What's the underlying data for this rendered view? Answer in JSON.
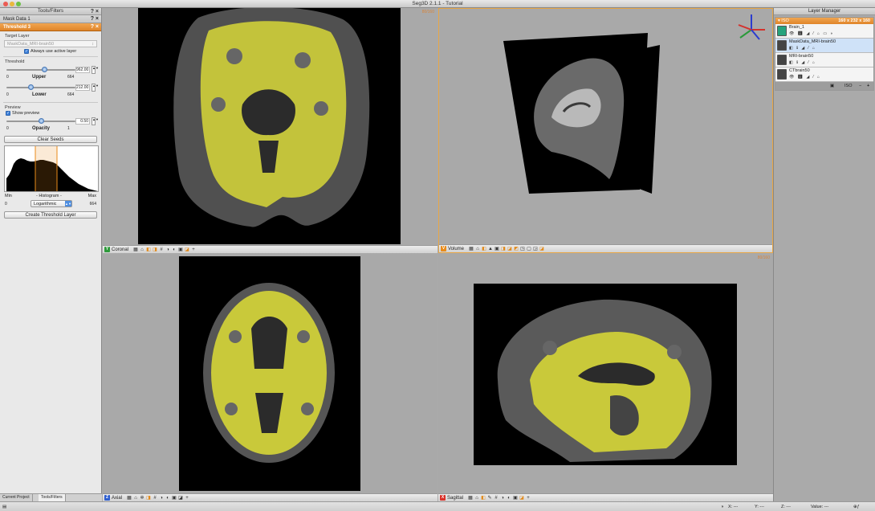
{
  "window": {
    "title": "Seg3D 2.1.1 - Tutorial"
  },
  "tools": {
    "panel_title": "Tools/Filters",
    "buttons": "? ×",
    "mask_tool": "Mask Data 1",
    "threshold_tool": "Threshold 3",
    "target_layer_label": "Target Layer",
    "target_layer_value": "MaskData_MRI-brain50",
    "always_use_active": "Always use active layer",
    "threshold_label": "Threshold",
    "upper": {
      "label": "Upper",
      "value": "962.00",
      "min": "0",
      "max": "664",
      "fraction": 0.55
    },
    "lower": {
      "label": "Lower",
      "value": "212.00",
      "min": "0",
      "max": "664",
      "fraction": 0.35
    },
    "preview_label": "Preview",
    "show_preview": "Show preview",
    "opacity": {
      "label": "Opacity",
      "value": "0.50",
      "min": "0",
      "max": "1",
      "fraction": 0.5
    },
    "clear_seeds": "Clear Seeds",
    "histogram_min": "Min",
    "histogram_title": "- Histogram -",
    "histogram_max": "Max",
    "histogram_scale_min": "0",
    "histogram_scale_max": "664",
    "histogram_mode": "Logarithmic",
    "create_layer": "Create Threshold Layer",
    "tabs": [
      "Current Project",
      "Tools/Filters"
    ]
  },
  "viewers": {
    "coronal": {
      "label": "Coronal",
      "slice": "80/160"
    },
    "volume": {
      "label": "Volume"
    },
    "axial": {
      "label": "Axial"
    },
    "sagittal": {
      "label": "Sagittal",
      "slice": "80/160"
    }
  },
  "layers": {
    "title": "Layer Manager",
    "group_label": "ISO",
    "group_dims": "160 x 232 x 160",
    "items": [
      {
        "name": "Brain_1",
        "type": "mask",
        "selected": false
      },
      {
        "name": "MaskData_MRI-brain50",
        "type": "mask",
        "selected": true
      },
      {
        "name": "MRI-brain50",
        "type": "data",
        "selected": false
      },
      {
        "name": "CTbrain50",
        "type": "data",
        "selected": false
      }
    ],
    "footer_iso": "ISO"
  },
  "status": {
    "x": "X: ---",
    "y": "Y: ---",
    "z": "Z: ---",
    "value": "Value: ---"
  },
  "colors": {
    "accent": "#e0852a",
    "mask": "#d8d83a",
    "selection": "#cfe2f8"
  }
}
